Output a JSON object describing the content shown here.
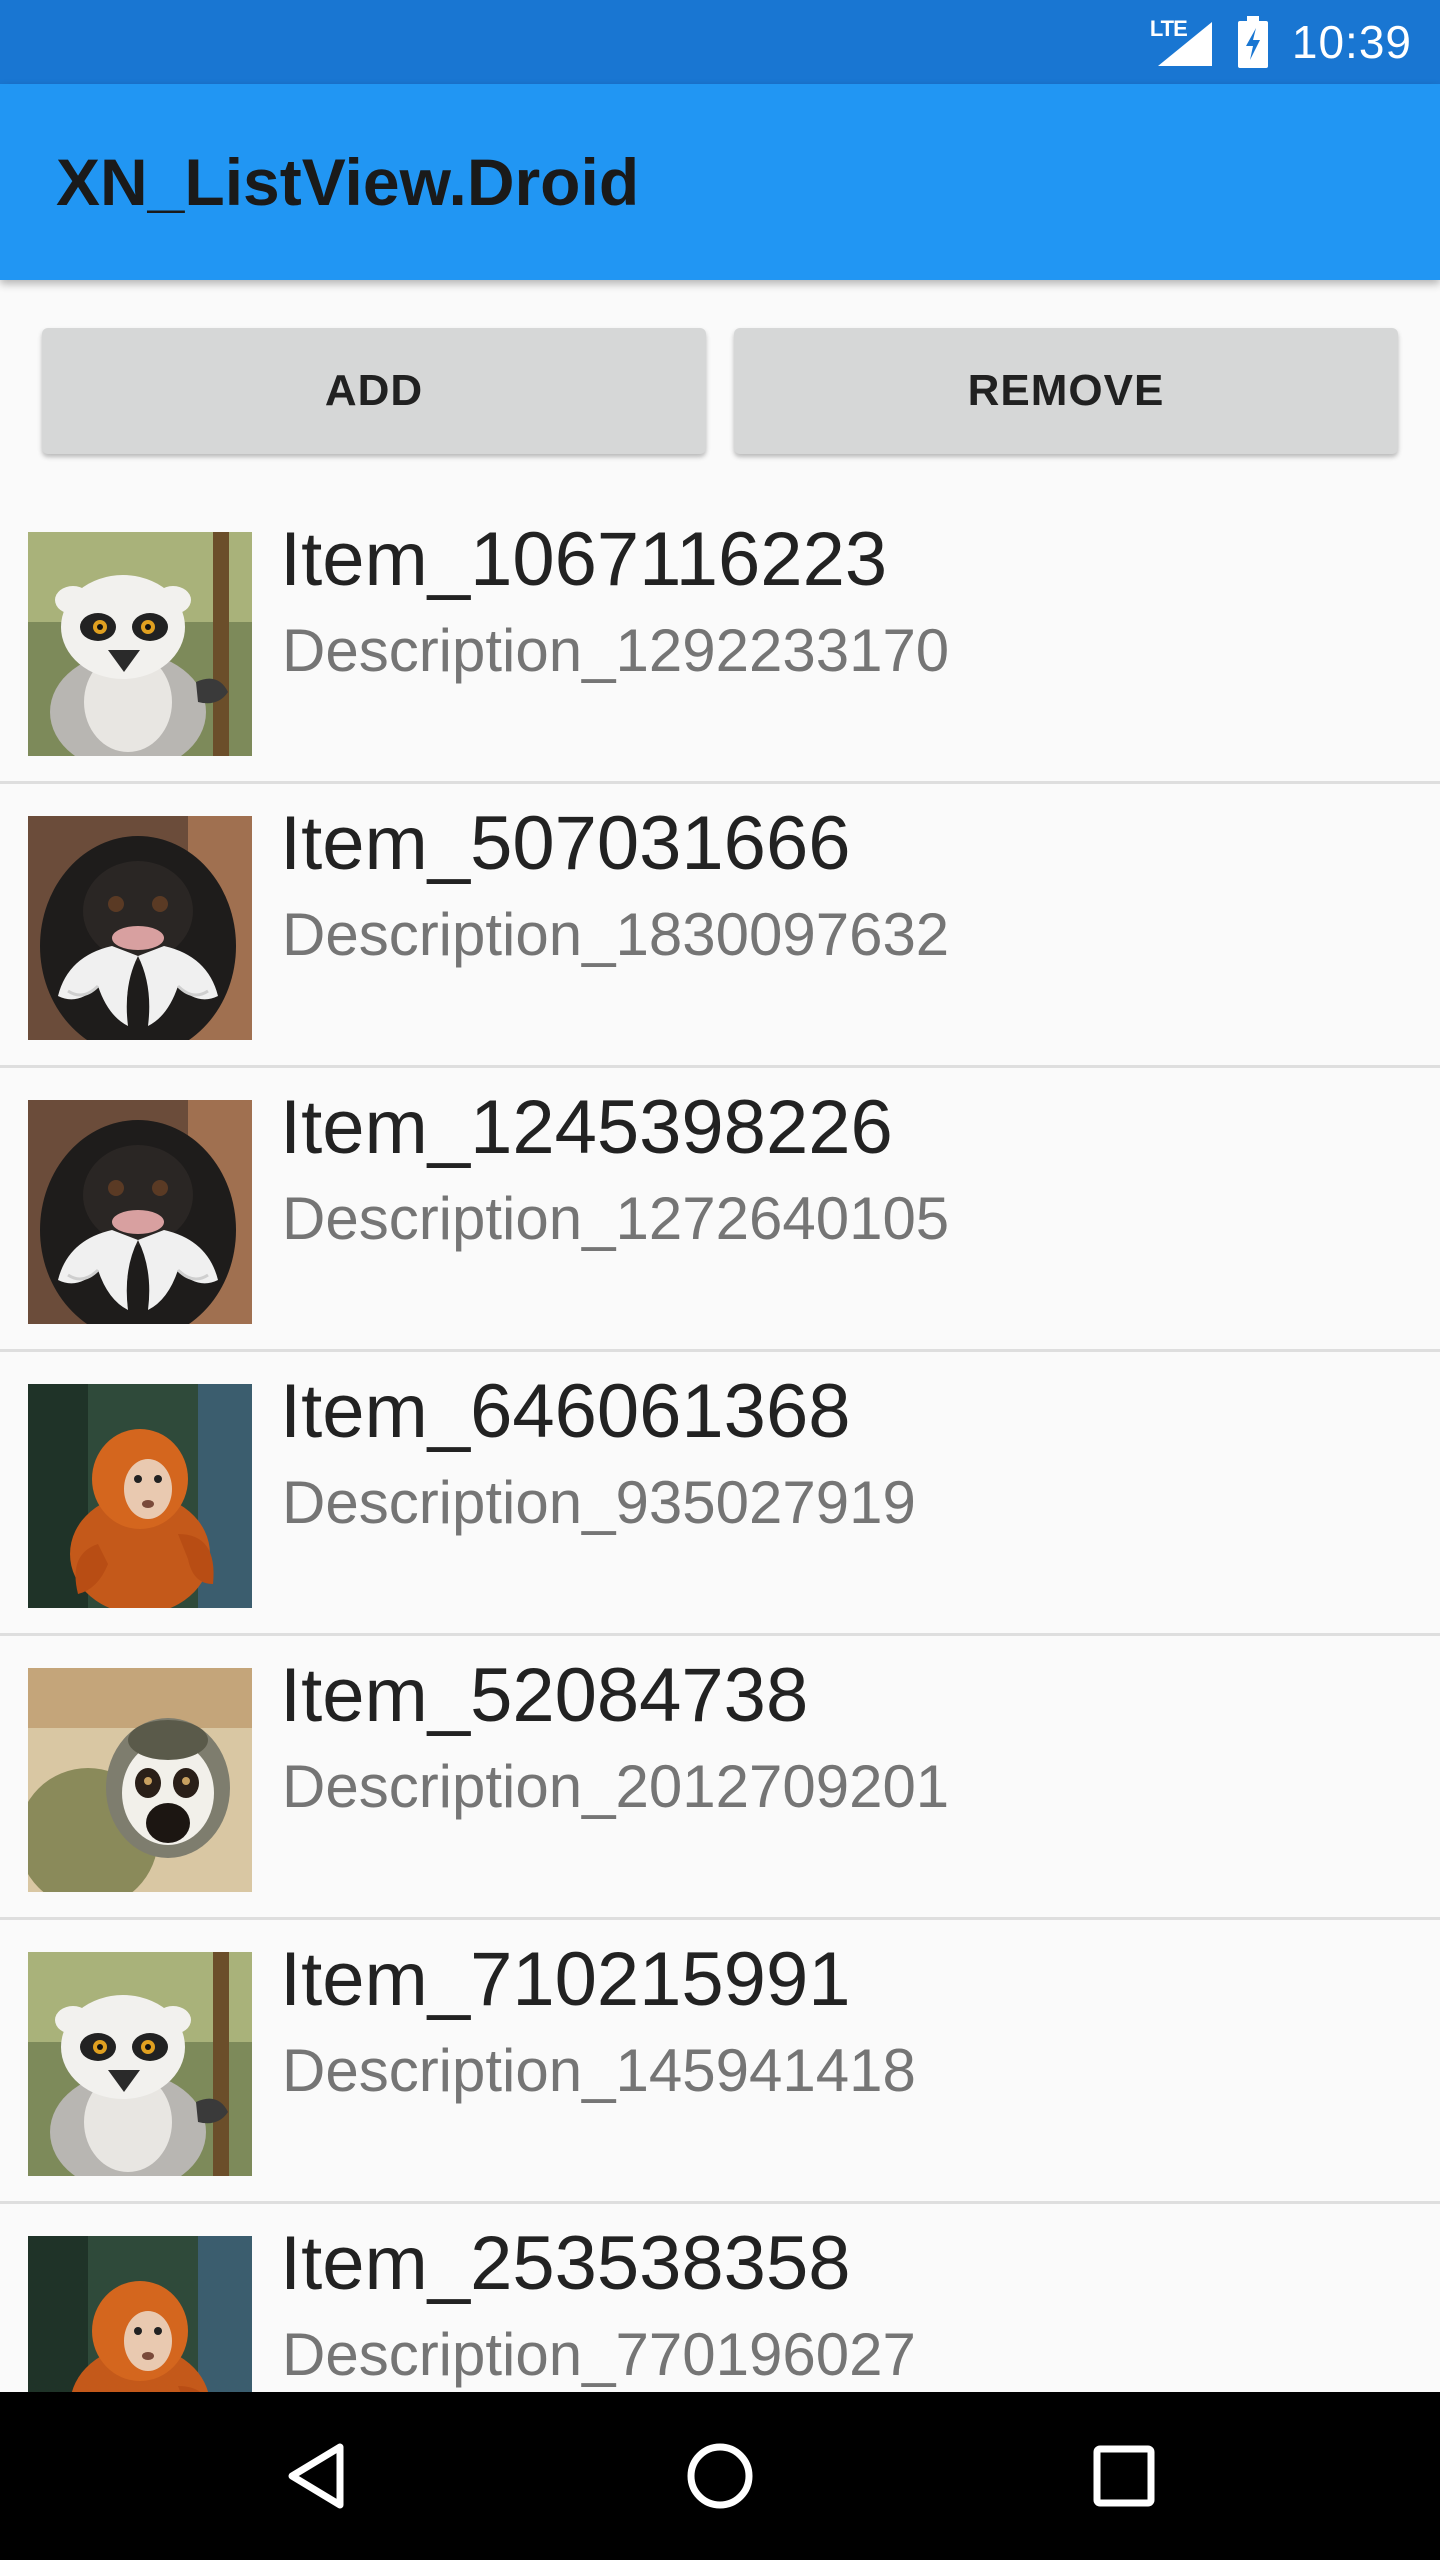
{
  "status_bar": {
    "network_label": "LTE",
    "time": "10:39",
    "icons": [
      "lte-signal-icon",
      "battery-charging-icon"
    ]
  },
  "app_bar": {
    "title": "XN_ListView.Droid"
  },
  "buttons": {
    "add_label": "ADD",
    "remove_label": "REMOVE"
  },
  "list": {
    "items": [
      {
        "title": "Item_1067116223",
        "description": "Description_1292233170",
        "image": "ring-tailed-lemur"
      },
      {
        "title": "Item_507031666",
        "description": "Description_1830097632",
        "image": "emperor-tamarin"
      },
      {
        "title": "Item_1245398226",
        "description": "Description_1272640105",
        "image": "emperor-tamarin"
      },
      {
        "title": "Item_646061368",
        "description": "Description_935027919",
        "image": "golden-langur"
      },
      {
        "title": "Item_52084738",
        "description": "Description_2012709201",
        "image": "squirrel-monkey"
      },
      {
        "title": "Item_710215991",
        "description": "Description_145941418",
        "image": "ring-tailed-lemur"
      },
      {
        "title": "Item_253538358",
        "description": "Description_770196027",
        "image": "golden-langur"
      }
    ]
  },
  "nav_bar": {
    "icons": [
      "back-icon",
      "home-icon",
      "recent-apps-icon"
    ]
  },
  "colors": {
    "status_bar": "#1976D2",
    "app_bar": "#2196F3",
    "button": "#D6D7D7",
    "background": "#FAFAFA"
  }
}
